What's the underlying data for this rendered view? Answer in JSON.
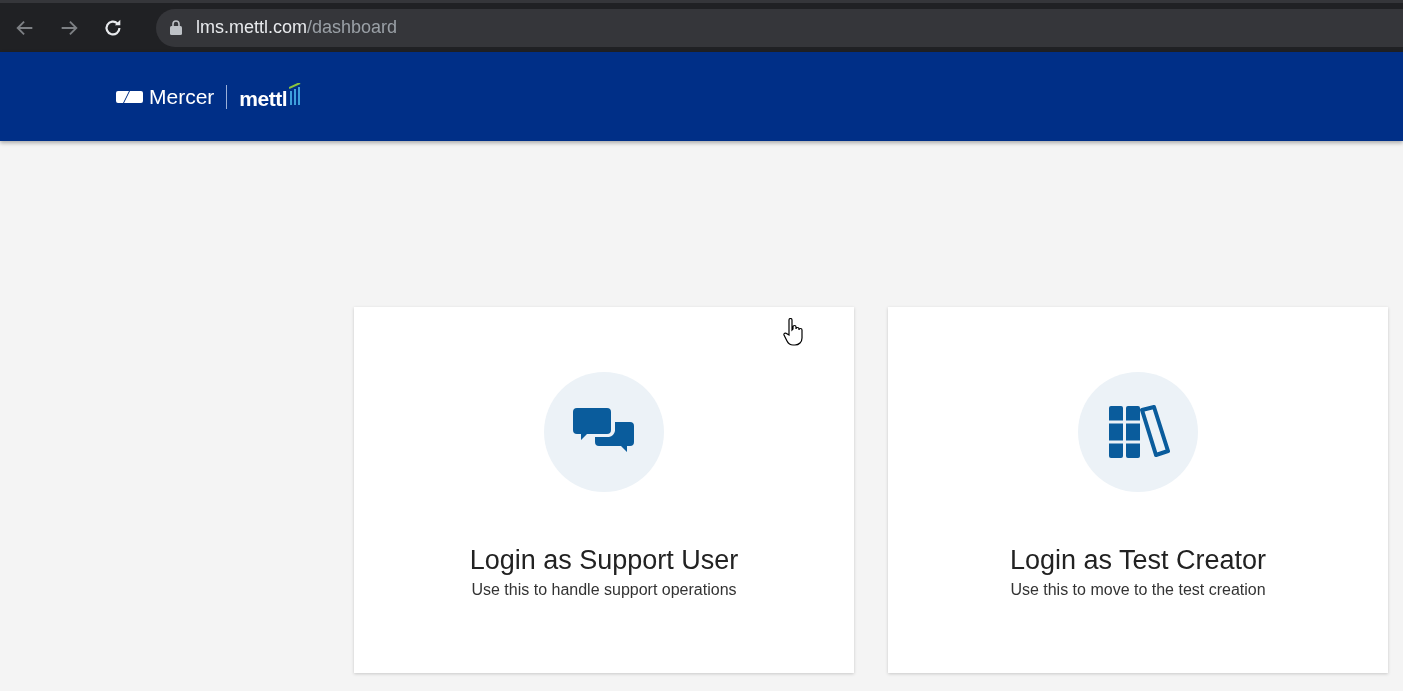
{
  "browser": {
    "url_host": "lms.mettl.com",
    "url_path": "/dashboard"
  },
  "header": {
    "brand": "Mercer",
    "product": "mettl"
  },
  "cards": [
    {
      "kind": "chat",
      "title": "Login as Support User",
      "subtitle": "Use this to handle support operations"
    },
    {
      "kind": "books",
      "title": "Login as Test Creator",
      "subtitle": "Use this to move to the test creation"
    }
  ]
}
